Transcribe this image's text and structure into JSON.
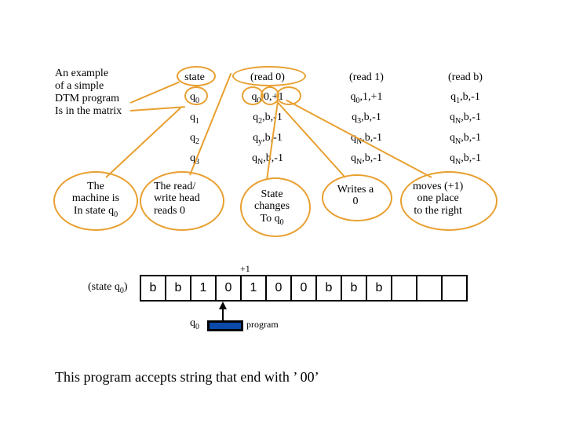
{
  "intro": {
    "l1": "An example",
    "l2": "of a simple",
    "l3": "DTM program",
    "l4": "Is in the matrix"
  },
  "table": {
    "hState": "state",
    "hR0": "(read  0)",
    "hR1": "(read  1)",
    "hRb": "(read  b)",
    "rows": [
      {
        "s": "q",
        "si": "0",
        "c0": "q",
        "c0i": "0",
        "c0t": ",0,+1",
        "c1": "q",
        "c1i": "0",
        "c1t": ",1,+1",
        "cb": "q",
        "cbi": "1",
        "cbt": ",b,-1"
      },
      {
        "s": "q",
        "si": "1",
        "c0": "q",
        "c0i": "2",
        "c0t": ",b,-1",
        "c1": "q",
        "c1i": "3",
        "c1t": ",b,-1",
        "cb": "q",
        "cbi": "N",
        "cbt": ",b,-1"
      },
      {
        "s": "q",
        "si": "2",
        "c0": "q",
        "c0i": "y",
        "c0t": ",b,-1",
        "c1": "q",
        "c1i": "N",
        "c1t": ",b,-1",
        "cb": "q",
        "cbi": "N",
        "cbt": ",b,-1"
      },
      {
        "s": "q",
        "si": "3",
        "c0": "q",
        "c0i": "N",
        "c0t": ",b,-1",
        "c1": "q",
        "c1i": "N",
        "c1t": ",b,-1",
        "cb": "q",
        "cbi": "N",
        "cbt": ",b,-1"
      }
    ]
  },
  "bubbles": {
    "b1a": "The",
    "b1b": "machine is",
    "b1c": "In state q",
    "b1ci": "0",
    "b2a": "The read/",
    "b2b": "write head",
    "b2c": "reads  0",
    "b3a": "State",
    "b3b": "changes",
    "b3c": "To q",
    "b3ci": "0",
    "b4a": "Writes a",
    "b4b": "0",
    "b5a": "moves (+1)",
    "b5b": "one place",
    "b5c": "to the right"
  },
  "tape": {
    "label": "(state q",
    "labeli": "0",
    "labelEnd": ")",
    "cells": [
      "b",
      "b",
      "1",
      "0",
      "1",
      "0",
      "0",
      "b",
      "b",
      "b",
      "",
      "",
      ""
    ],
    "plus1": "+1",
    "head": "q",
    "headi": "0",
    "prog": "program"
  },
  "conclusion": "This program accepts string that end with ’ 00’"
}
